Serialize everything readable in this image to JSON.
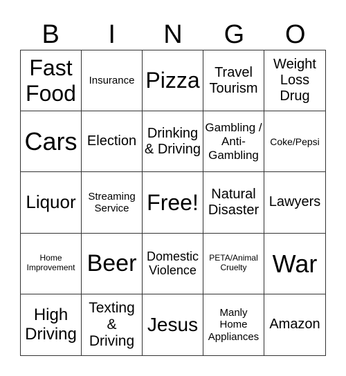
{
  "header": [
    "B",
    "I",
    "N",
    "G",
    "O"
  ],
  "cells": [
    {
      "text": "Fast Food",
      "size": 32
    },
    {
      "text": "Insurance",
      "size": 15
    },
    {
      "text": "Pizza",
      "size": 32
    },
    {
      "text": "Travel Tourism",
      "size": 20
    },
    {
      "text": "Weight Loss Drug",
      "size": 20
    },
    {
      "text": "Cars",
      "size": 36
    },
    {
      "text": "Election",
      "size": 20
    },
    {
      "text": "Drinking & Driving",
      "size": 20
    },
    {
      "text": "Gambling / Anti-Gambling",
      "size": 17
    },
    {
      "text": "Coke/Pepsi",
      "size": 14
    },
    {
      "text": "Liquor",
      "size": 26
    },
    {
      "text": "Streaming Service",
      "size": 15
    },
    {
      "text": "Free!",
      "size": 32
    },
    {
      "text": "Natural Disaster",
      "size": 20
    },
    {
      "text": "Lawyers",
      "size": 20
    },
    {
      "text": "Home Improvement",
      "size": 12
    },
    {
      "text": "Beer",
      "size": 34
    },
    {
      "text": "Domestic Violence",
      "size": 18
    },
    {
      "text": "PETA/Animal Cruelty",
      "size": 12
    },
    {
      "text": "War",
      "size": 36
    },
    {
      "text": "High Driving",
      "size": 24
    },
    {
      "text": "Texting & Driving",
      "size": 21
    },
    {
      "text": "Jesus",
      "size": 28
    },
    {
      "text": "Manly Home Appliances",
      "size": 15
    },
    {
      "text": "Amazon",
      "size": 20
    }
  ]
}
